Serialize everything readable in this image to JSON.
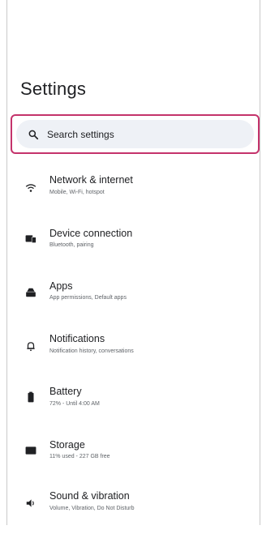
{
  "header": {
    "title": "Settings"
  },
  "search": {
    "placeholder": "Search settings"
  },
  "items": [
    {
      "title": "Network & internet",
      "subtitle": "Mobile, Wi-Fi, hotspot",
      "icon": "wifi-icon"
    },
    {
      "title": "Device connection",
      "subtitle": "Bluetooth, pairing",
      "icon": "devices-icon"
    },
    {
      "title": "Apps",
      "subtitle": "App permissions, Default apps",
      "icon": "apps-icon"
    },
    {
      "title": "Notifications",
      "subtitle": "Notification history, conversations",
      "icon": "bell-icon"
    },
    {
      "title": "Battery",
      "subtitle": "72% - Until 4:00 AM",
      "icon": "battery-icon"
    },
    {
      "title": "Storage",
      "subtitle": "11% used - 227 GB free",
      "icon": "storage-icon"
    },
    {
      "title": "Sound & vibration",
      "subtitle": "Volume, Vibration, Do Not Disturb",
      "icon": "sound-icon"
    }
  ],
  "colors": {
    "accent": "#c4336b",
    "search_bg": "#eef1f6"
  }
}
